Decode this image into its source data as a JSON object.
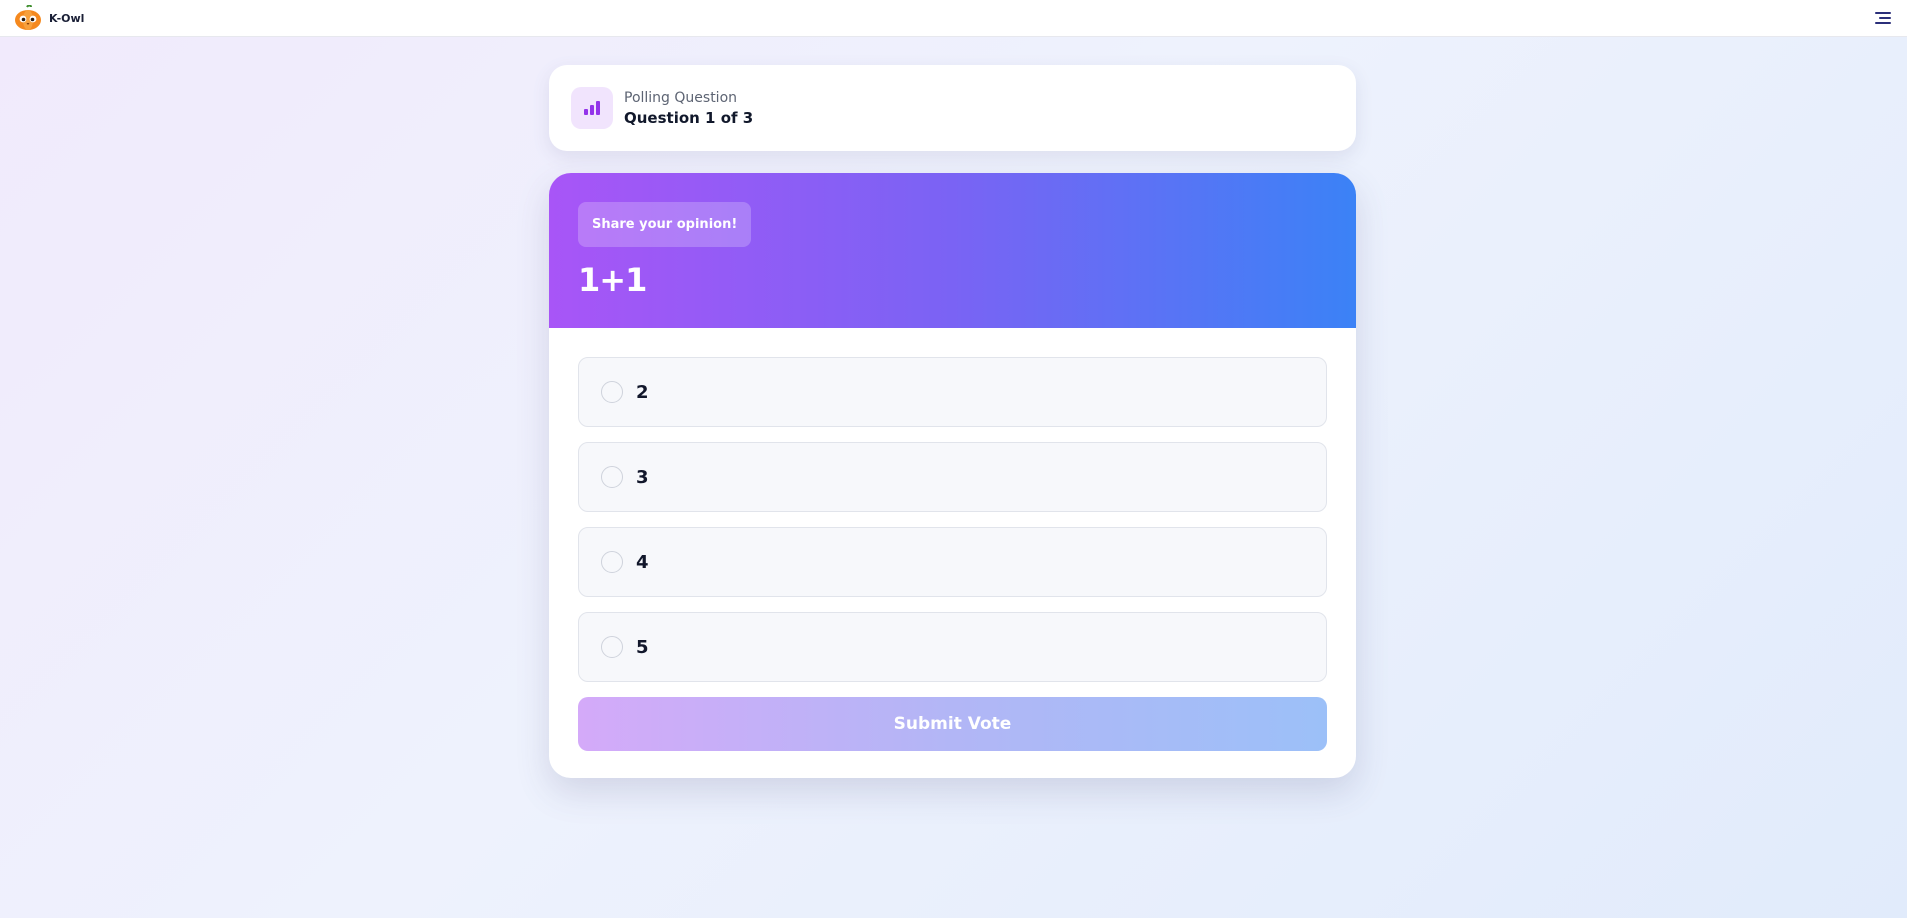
{
  "app": {
    "name": "K-Owl",
    "logo_icon": "pumpkin-owl-logo",
    "menu_icon": "hamburger-menu-icon"
  },
  "header": {
    "icon": "bar-chart-icon",
    "subtitle": "Polling Question",
    "progress": "Question 1 of 3"
  },
  "poll": {
    "badge": "Share your opinion!",
    "question": "1+1",
    "options": [
      {
        "label": "2"
      },
      {
        "label": "3"
      },
      {
        "label": "4"
      },
      {
        "label": "5"
      }
    ],
    "submit_label": "Submit Vote"
  },
  "colors": {
    "banner_start": "#a855f7",
    "banner_end": "#3b82f6",
    "accent_icon": "#9333ea",
    "menu": "#2b2f7a"
  }
}
